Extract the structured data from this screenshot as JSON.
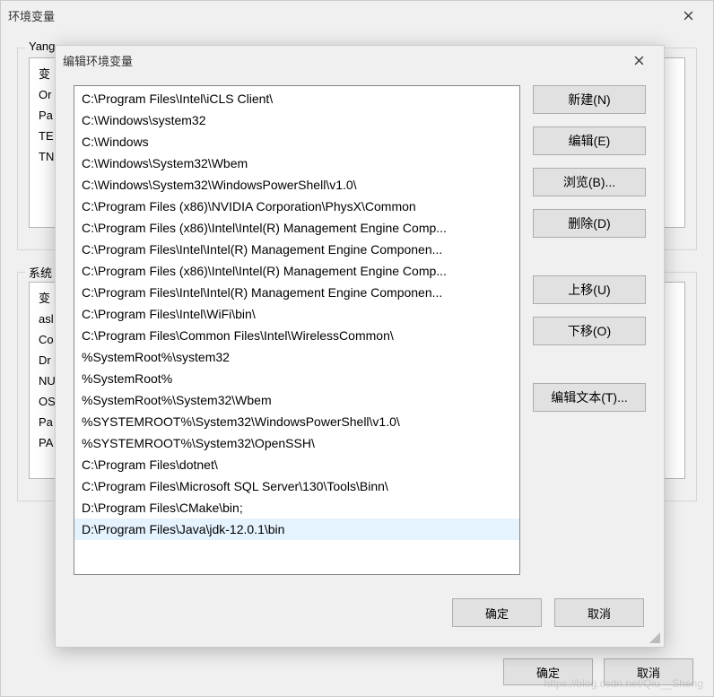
{
  "outer": {
    "title": "环境变量",
    "user_group_title": "Yang",
    "system_group_title": "系统",
    "user_vars": [
      "变",
      "Or",
      "Pa",
      "TE",
      "TN"
    ],
    "sys_vars": [
      "变",
      "asl",
      "Co",
      "Dr",
      "NU",
      "OS",
      "Pa",
      "PA",
      ""
    ],
    "ok": "确定",
    "cancel": "取消"
  },
  "inner": {
    "title": "编辑环境变量",
    "paths": [
      "C:\\Program Files\\Intel\\iCLS Client\\",
      "C:\\Windows\\system32",
      "C:\\Windows",
      "C:\\Windows\\System32\\Wbem",
      "C:\\Windows\\System32\\WindowsPowerShell\\v1.0\\",
      "C:\\Program Files (x86)\\NVIDIA Corporation\\PhysX\\Common",
      "C:\\Program Files (x86)\\Intel\\Intel(R) Management Engine Comp...",
      "C:\\Program Files\\Intel\\Intel(R) Management Engine Componen...",
      "C:\\Program Files (x86)\\Intel\\Intel(R) Management Engine Comp...",
      "C:\\Program Files\\Intel\\Intel(R) Management Engine Componen...",
      "C:\\Program Files\\Intel\\WiFi\\bin\\",
      "C:\\Program Files\\Common Files\\Intel\\WirelessCommon\\",
      "%SystemRoot%\\system32",
      "%SystemRoot%",
      "%SystemRoot%\\System32\\Wbem",
      "%SYSTEMROOT%\\System32\\WindowsPowerShell\\v1.0\\",
      "%SYSTEMROOT%\\System32\\OpenSSH\\",
      "C:\\Program Files\\dotnet\\",
      "C:\\Program Files\\Microsoft SQL Server\\130\\Tools\\Binn\\",
      "D:\\Program Files\\CMake\\bin;",
      "D:\\Program Files\\Java\\jdk-12.0.1\\bin"
    ],
    "selected_index": 20,
    "buttons": {
      "new": "新建(N)",
      "edit": "编辑(E)",
      "browse": "浏览(B)...",
      "delete": "删除(D)",
      "move_up": "上移(U)",
      "move_down": "下移(O)",
      "edit_text": "编辑文本(T)..."
    },
    "ok": "确定",
    "cancel": "取消"
  },
  "watermark": "https://blog.csdn.net/Qiu__Sheng"
}
